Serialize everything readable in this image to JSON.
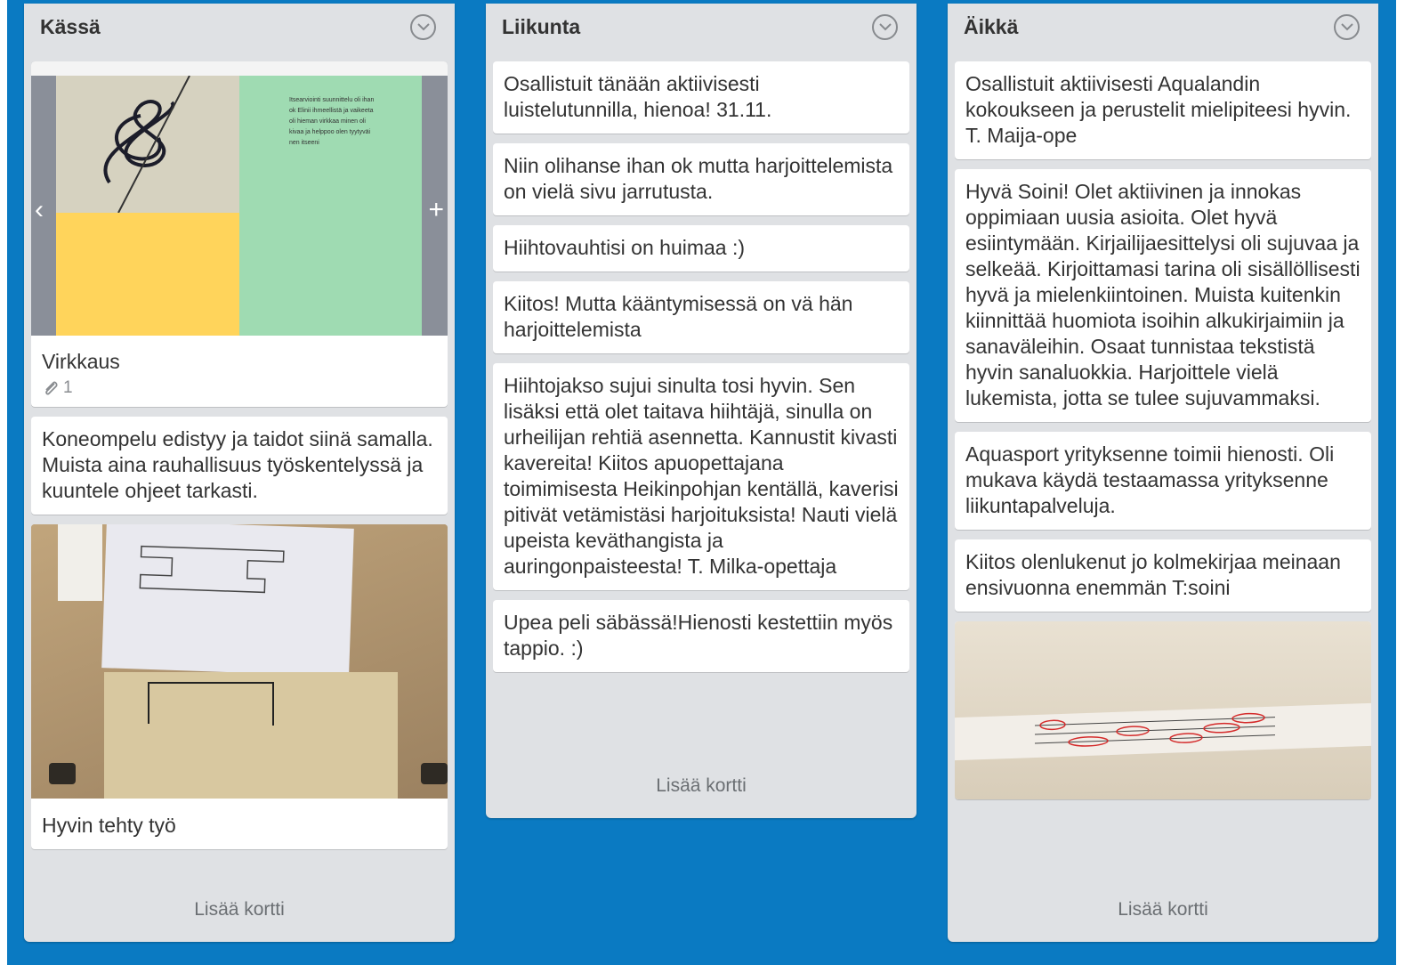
{
  "lists": [
    {
      "title": "Kässä",
      "add_card_label": "Lisää kortti",
      "cards": [
        {
          "title": "Virkkaus",
          "attachments": "1",
          "cover_note": "Itsearviointi suunnittelu oli ihan ok Elinii ihmeellistä ja vaikeeta oli hieman virkkaa minen oli kivaa ja helppoo olen tyytyväi nen itseeni"
        },
        {
          "text": "Koneompelu edistyy ja taidot siinä samalla. Muista aina rauhallisuus työskentelyssä ja kuuntele ohjeet tarkasti."
        },
        {
          "title": "Hyvin tehty työ"
        }
      ]
    },
    {
      "title": "Liikunta",
      "add_card_label": "Lisää kortti",
      "cards": [
        {
          "text": "Osallistuit tänään aktiivisesti luistelutunnilla, hienoa! 31.11."
        },
        {
          "text": "Niin olihanse ihan ok mutta harjoittelemista on vielä sivu jarrutusta."
        },
        {
          "text": "Hiihtovauhtisi on huimaa :)"
        },
        {
          "text": "Kiitos! Mutta kääntymisessä on vä hän harjoittelemista"
        },
        {
          "text": "Hiihtojakso sujui sinulta tosi hyvin. Sen lisäksi että olet taitava hiihtäjä, sinulla on urheilijan rehtiä asennetta. Kannustit kivasti kavereita! Kiitos apuopettajana toimimisesta Heikinpohjan kentällä, kaverisi pitivät vetämistäsi harjoituksista! Nauti vielä upeista keväthangista ja auringonpaisteesta! T. Milka-opettaja"
        },
        {
          "text": "Upea peli säbässä!Hienosti kestettiin myös tappio. :)"
        }
      ]
    },
    {
      "title": "Äikkä",
      "add_card_label": "Lisää kortti",
      "cards": [
        {
          "text": "Osallistuit aktiivisesti Aqualandin kokoukseen ja perustelit mielipiteesi hyvin. T. Maija-ope"
        },
        {
          "text": "Hyvä Soini! Olet aktiivinen ja innokas oppimiaan uusia asioita. Olet hyvä esiintymään. Kirjailijaesittelysi oli sujuvaa ja selkeää. Kirjoittamasi tarina oli sisällöllisesti hyvä ja mielenkiintoinen. Muista kuitenkin kiinnittää huomiota isoihin alkukirjaimiin ja sanaväleihin. Osaat tunnistaa tekstistä hyvin sanaluokkia. Harjoittele vielä lukemista, jotta se tulee sujuvammaksi."
        },
        {
          "text": "Aquasport yrityksenne toimii hienosti. Oli mukava käydä testaamassa yrityksenne liikuntapalveluja."
        },
        {
          "text": "Kiitos olenlukenut jo kolmekirjaa meinaan ensivuonna enemmän T:soini"
        },
        {
          "image": "photo-of-corrected-text"
        }
      ]
    }
  ],
  "colors": {
    "board_background": "#0a7ac2",
    "list_background": "#dfe1e4",
    "card_background": "#ffffff"
  },
  "icons": [
    "chevron-down-icon",
    "paperclip-icon",
    "chevron-left-icon",
    "plus-icon"
  ]
}
